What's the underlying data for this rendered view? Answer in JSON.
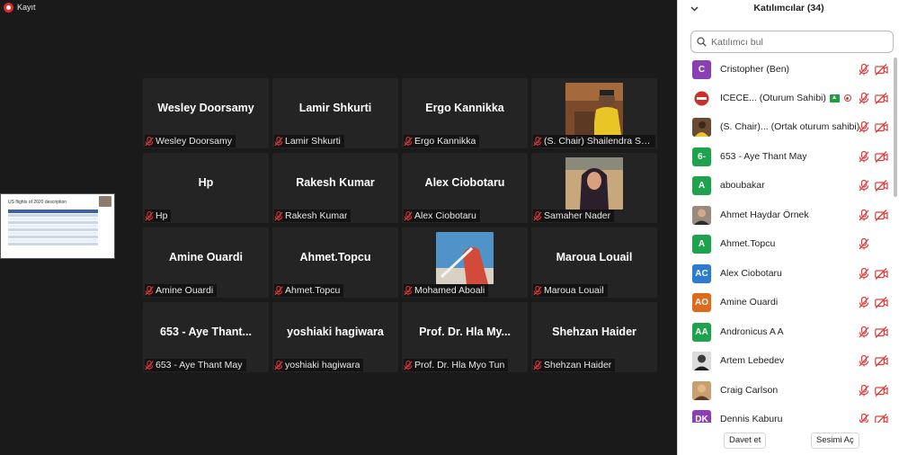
{
  "recording": {
    "label": "Kayıt"
  },
  "shared_screen": {
    "title": "US flights of 2020 description"
  },
  "tiles": [
    {
      "name": "Wesley Doorsamy",
      "caption": "Wesley Doorsamy"
    },
    {
      "name": "Lamir Shkurti",
      "caption": "Lamir Shkurti"
    },
    {
      "name": "Ergo Kannikka",
      "caption": "Ergo Kannikka"
    },
    {
      "name": "",
      "caption": "(S. Chair) Shailendra Sin..."
    },
    {
      "name": "Hp",
      "caption": "Hp"
    },
    {
      "name": "Rakesh Kumar",
      "caption": "Rakesh Kumar"
    },
    {
      "name": "Alex Ciobotaru",
      "caption": "Alex Ciobotaru"
    },
    {
      "name": "",
      "caption": "Samaher Nader"
    },
    {
      "name": "Amine Ouardi",
      "caption": "Amine Ouardi"
    },
    {
      "name": "Ahmet.Topcu",
      "caption": "Ahmet.Topcu"
    },
    {
      "name": "",
      "caption": "Mohamed Aboali"
    },
    {
      "name": "Maroua Louail",
      "caption": "Maroua Louail"
    },
    {
      "name": "653 - Aye Thant...",
      "caption": "653 - Aye Thant May"
    },
    {
      "name": "yoshiaki hagiwara",
      "caption": "yoshiaki hagiwara"
    },
    {
      "name": "Prof. Dr. Hla My...",
      "caption": "Prof. Dr. Hla Myo Tun"
    },
    {
      "name": "Shehzan Haider",
      "caption": "Shehzan Haider"
    }
  ],
  "panel": {
    "title": "Katılımcılar (34)",
    "search_placeholder": "Katılımcı bul",
    "participants": [
      {
        "avatar": "C",
        "avatar_color": "#8a3fb5",
        "name": "Cristopher (Ben)",
        "cam": true
      },
      {
        "avatar": "",
        "avatar_color": "#c9302c",
        "name": "ICECE...   (Oturum Sahibi)",
        "cam": true
      },
      {
        "avatar": "",
        "avatar_color": "#d8b21a",
        "name": "(S. Chair)...  (Ortak oturum sahibi)",
        "cam": true
      },
      {
        "avatar": "6-",
        "avatar_color": "#1da34c",
        "name": "653 - Aye Thant May",
        "cam": true
      },
      {
        "avatar": "A",
        "avatar_color": "#1da34c",
        "name": "aboubakar",
        "cam": true
      },
      {
        "avatar": "",
        "avatar_color": "#6b5a4e",
        "name": "Ahmet Haydar Örnek",
        "cam": true
      },
      {
        "avatar": "A",
        "avatar_color": "#1da34c",
        "name": "Ahmet.Topcu",
        "cam": false
      },
      {
        "avatar": "AC",
        "avatar_color": "#2d7bd0",
        "name": "Alex Ciobotaru",
        "cam": true
      },
      {
        "avatar": "AO",
        "avatar_color": "#e06a1b",
        "name": "Amine Ouardi",
        "cam": true
      },
      {
        "avatar": "AA",
        "avatar_color": "#1da34c",
        "name": "Andronicus A A",
        "cam": true
      },
      {
        "avatar": "",
        "avatar_color": "#444444",
        "name": "Artem Lebedev",
        "cam": true
      },
      {
        "avatar": "",
        "avatar_color": "#7a5a3a",
        "name": "Craig Carlson",
        "cam": true
      },
      {
        "avatar": "DK",
        "avatar_color": "#8a3fb5",
        "name": "Dennis Kaburu",
        "cam": true
      }
    ],
    "invite_label": "Davet et",
    "unmute_label": "Sesimi Aç"
  }
}
